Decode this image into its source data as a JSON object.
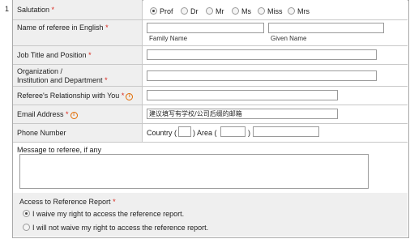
{
  "row_number": "1",
  "required_mark": "*",
  "info_glyph": "i",
  "salutation": {
    "label": "Salutation",
    "options": [
      "Prof",
      "Dr",
      "Mr",
      "Ms",
      "Miss",
      "Mrs"
    ],
    "selected": "Prof"
  },
  "name": {
    "label": "Name of referee in English",
    "family_value": "",
    "given_value": "",
    "family_caption": "Family Name",
    "given_caption": "Given Name"
  },
  "job": {
    "label": "Job Title and Position",
    "value": ""
  },
  "org": {
    "label_line1": "Organization /",
    "label_line2": "Institution and Department",
    "value": ""
  },
  "relationship": {
    "label": "Referee's Relationship with You",
    "value": ""
  },
  "email": {
    "label": "Email Address",
    "value": "建议填写有学校/公司后缀的邮箱"
  },
  "phone": {
    "label": "Phone Number",
    "country_label": "Country (",
    "country_close": ")",
    "area_label": "Area (",
    "area_close": ")",
    "country_value": "",
    "area_value": "",
    "number_value": ""
  },
  "message": {
    "label": "Message to referee, if any",
    "value": ""
  },
  "access": {
    "label": "Access to Reference Report",
    "options": [
      {
        "label": "I waive my right to access the reference report.",
        "selected": true
      },
      {
        "label": "I will not waive my right to access the reference report.",
        "selected": false
      }
    ]
  }
}
